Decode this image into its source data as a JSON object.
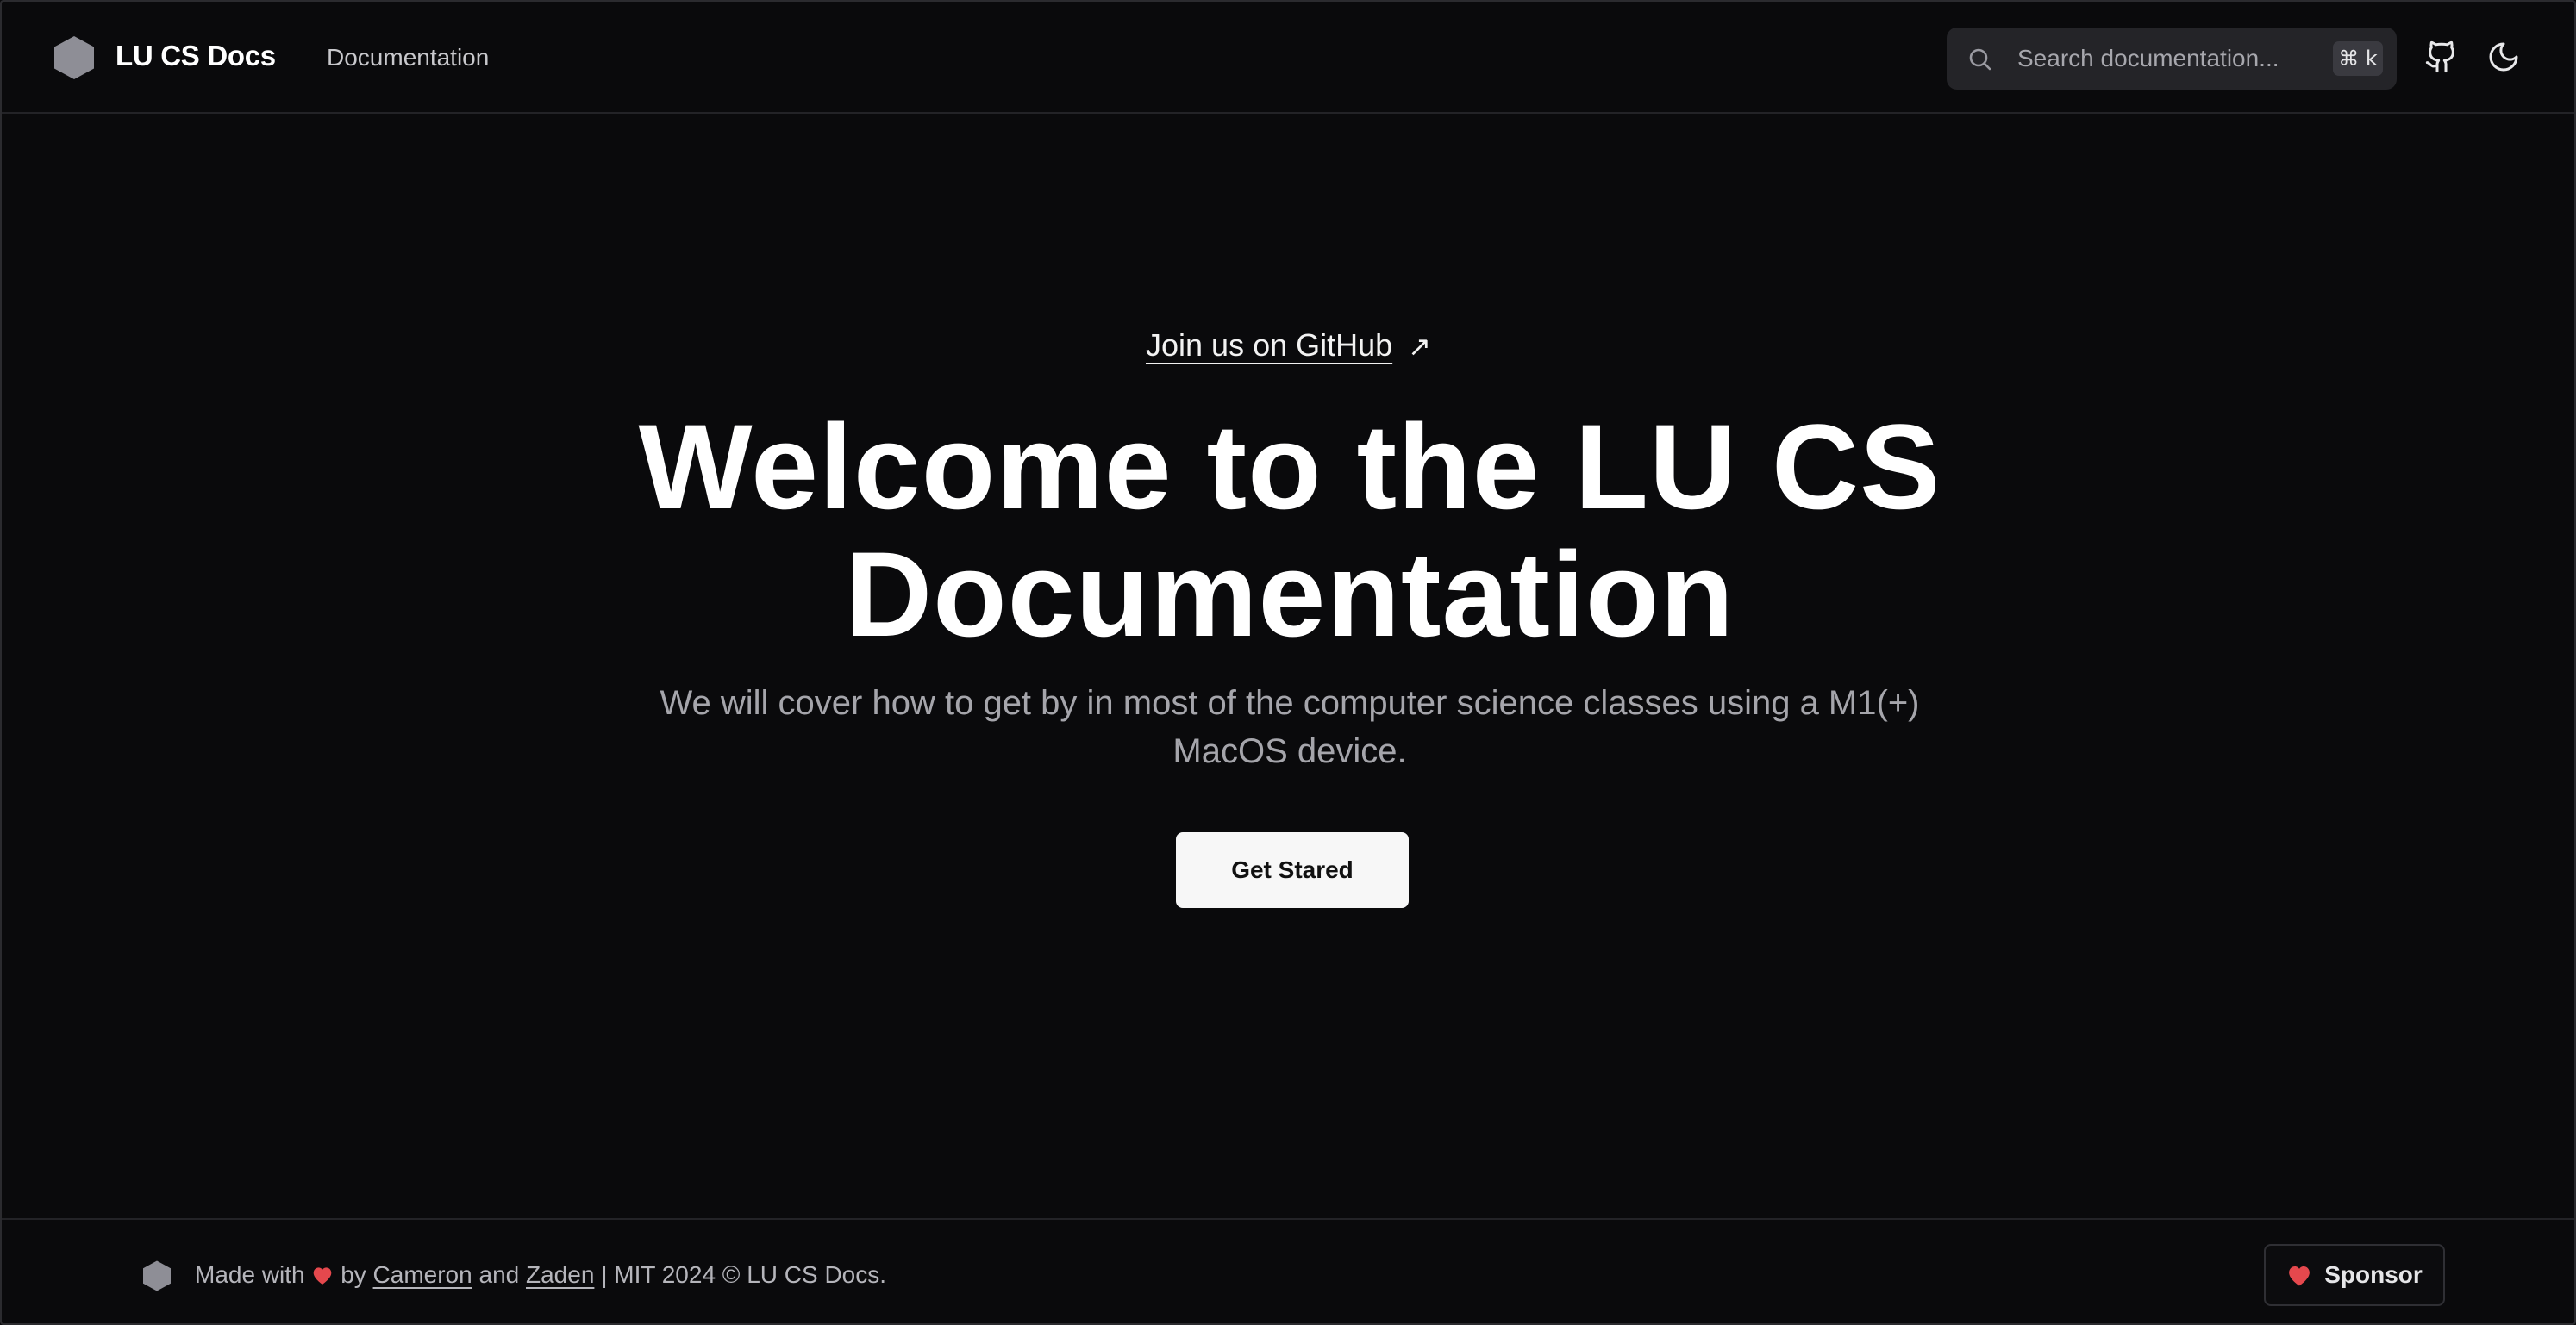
{
  "colors": {
    "background": "#0a0a0c",
    "primary_text": "#ffffff",
    "muted_text": "#a5a5ab",
    "search_bg": "#242428",
    "heart": "#e5484d",
    "logo": "#8e8e96"
  },
  "header": {
    "logo_icon": "hexagon-logo-icon",
    "brand": "LU CS Docs",
    "nav": [
      {
        "label": "Documentation"
      }
    ],
    "search": {
      "icon": "search-icon",
      "placeholder": "Search documentation...",
      "shortcut": "⌘ k"
    },
    "actions": [
      {
        "icon": "github-icon"
      },
      {
        "icon": "moon-icon"
      }
    ]
  },
  "hero": {
    "link_label": "Join us on GitHub",
    "link_arrow": "↗",
    "title_line1": "Welcome to the LU CS",
    "title_line2": "Documentation",
    "subtitle_line1": "We will cover how to get by in most of the computer science classes using a M1(+)",
    "subtitle_line2": "MacOS device.",
    "cta_label": "Get Stared"
  },
  "footer": {
    "made_with": "Made with",
    "by": "by",
    "author1": "Cameron",
    "and": "and",
    "author2": "Zaden",
    "rest": "| MIT 2024 © LU CS Docs.",
    "sponsor_label": "Sponsor"
  }
}
